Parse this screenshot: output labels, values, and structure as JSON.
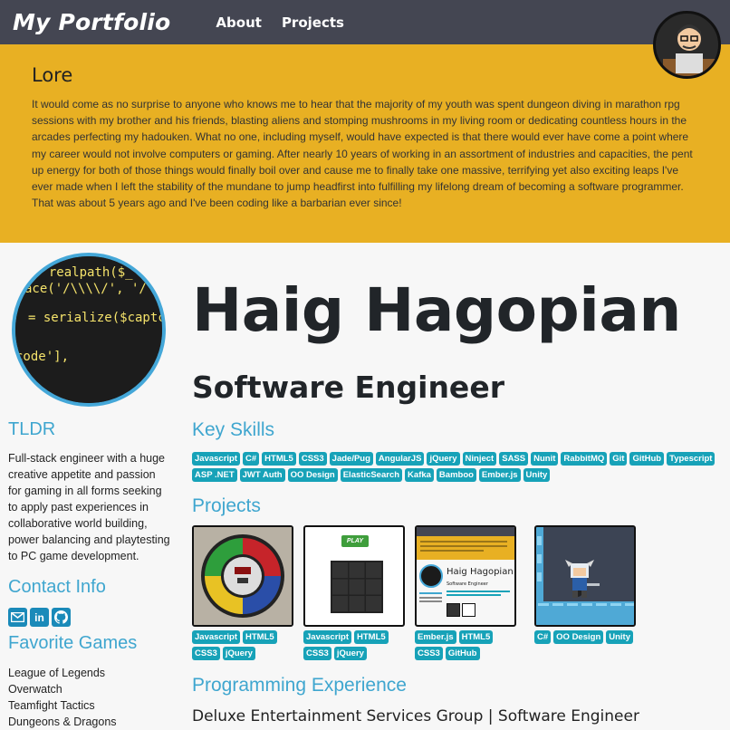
{
  "navbar": {
    "brand": "My Portfolio",
    "links": [
      "About",
      "Projects"
    ]
  },
  "lore": {
    "title": "Lore",
    "text": "It would come as no surprise to anyone who knows me to hear that the majority of my youth was spent dungeon diving in marathon rpg sessions with my brother and his friends, blasting aliens and stomping mushrooms in my living room or dedicating countless hours in the arcades perfecting my hadouken. What no one, including myself, would have expected is that there would ever have come a point where my career would not involve computers or gaming. After nearly 10 years of working in an assortment of industries and capacities, the pent up energy for both of those things would finally boil over and cause me to finally take one massive, terrifying yet also exciting leaps I've ever made when I left the stability of the mundane to jump headfirst into fulfilling my lifelong dream of becoming a software programmer. That was about 5 years ago and I've been coding like a barbarian ever since!"
  },
  "sidebar": {
    "tldr_title": "TLDR",
    "tldr_text": "Full-stack engineer with a huge creative appetite and passion for gaming in all forms seeking to apply past experiences in collaborative world building, power balancing and playtesting to PC game development.",
    "contact_title": "Contact Info",
    "contact_icons": [
      "envelope-icon",
      "linkedin-icon",
      "github-icon"
    ],
    "games_title": "Favorite Games",
    "games": [
      "League of Legends",
      "Overwatch",
      "Teamfight Tactics",
      "Dungeons & Dragons"
    ]
  },
  "main": {
    "name": "Haig Hagopian",
    "role": "Software Engineer",
    "skills_title": "Key Skills",
    "skills": [
      "Javascript",
      "C#",
      "HTML5",
      "CSS3",
      "Jade/Pug",
      "AngularJS",
      "jQuery",
      "Ninject",
      "SASS",
      "Nunit",
      "RabbitMQ",
      "Git",
      "GitHub",
      "Typescript",
      "ASP .NET",
      "JWT Auth",
      "OO Design",
      "ElasticSearch",
      "Kafka",
      "Bamboo",
      "Ember.js",
      "Unity"
    ],
    "projects_title": "Projects",
    "projects": [
      {
        "thumb": "simon-game",
        "tags": [
          "Javascript",
          "HTML5",
          "CSS3",
          "jQuery"
        ]
      },
      {
        "thumb": "puzzle-grid-game",
        "play_label": "PLAY",
        "tags": [
          "Javascript",
          "HTML5",
          "CSS3",
          "jQuery"
        ]
      },
      {
        "thumb": "portfolio-site",
        "mini_name": "Haig Hagopian",
        "mini_role": "Software Engineer",
        "tags": [
          "Ember.js",
          "HTML5",
          "CSS3",
          "GitHub"
        ]
      },
      {
        "thumb": "platformer-knight",
        "tags": [
          "C#",
          "OO Design",
          "Unity"
        ]
      }
    ],
    "experience_title": "Programming Experience",
    "job": "Deluxe Entertainment Services Group | Software Engineer"
  },
  "colors": {
    "navbar": "#444652",
    "lore_bg": "#e8b023",
    "accent": "#3fa6cf",
    "badge": "#17a2b8",
    "page_bg": "#f7f7f7"
  }
}
